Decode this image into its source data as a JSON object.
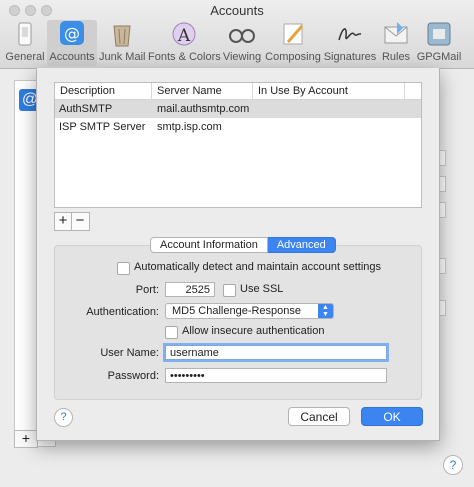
{
  "window": {
    "title": "Accounts"
  },
  "toolbar": {
    "items": [
      {
        "label": "General",
        "icon": "general-icon"
      },
      {
        "label": "Accounts",
        "icon": "at-sign-icon",
        "active": true
      },
      {
        "label": "Junk Mail",
        "icon": "junk-mail-icon"
      },
      {
        "label": "Fonts & Colors",
        "icon": "fonts-colors-icon"
      },
      {
        "label": "Viewing",
        "icon": "glasses-icon"
      },
      {
        "label": "Composing",
        "icon": "pencil-icon"
      },
      {
        "label": "Signatures",
        "icon": "signature-icon"
      },
      {
        "label": "Rules",
        "icon": "rules-icon"
      },
      {
        "label": "GPGMail",
        "icon": "gpgmail-icon"
      }
    ]
  },
  "smtp_table": {
    "headers": [
      "Description",
      "Server Name",
      "In Use By Account"
    ],
    "rows": [
      {
        "description": "AuthSMTP",
        "server": "mail.authsmtp.com",
        "in_use": "",
        "selected": true
      },
      {
        "description": "ISP SMTP Server",
        "server": "smtp.isp.com",
        "in_use": "",
        "selected": false
      }
    ]
  },
  "list_controls": {
    "add": "+",
    "remove": "−"
  },
  "tabs": {
    "account_information": "Account Information",
    "advanced": "Advanced",
    "selected": "Advanced"
  },
  "advanced": {
    "auto_detect_label": "Automatically detect and maintain account settings",
    "auto_detect_checked": false,
    "port_label": "Port:",
    "port_value": "2525",
    "use_ssl_label": "Use SSL",
    "use_ssl_checked": false,
    "auth_label": "Authentication:",
    "auth_value": "MD5 Challenge-Response",
    "insecure_label": "Allow insecure authentication",
    "insecure_checked": false,
    "username_label": "User Name:",
    "username_value": "username",
    "password_label": "Password:",
    "password_value": "•••••••••"
  },
  "buttons": {
    "help": "?",
    "cancel": "Cancel",
    "ok": "OK"
  },
  "colors": {
    "accent": "#3c84f0",
    "selected_row": "#dcdcdc"
  }
}
